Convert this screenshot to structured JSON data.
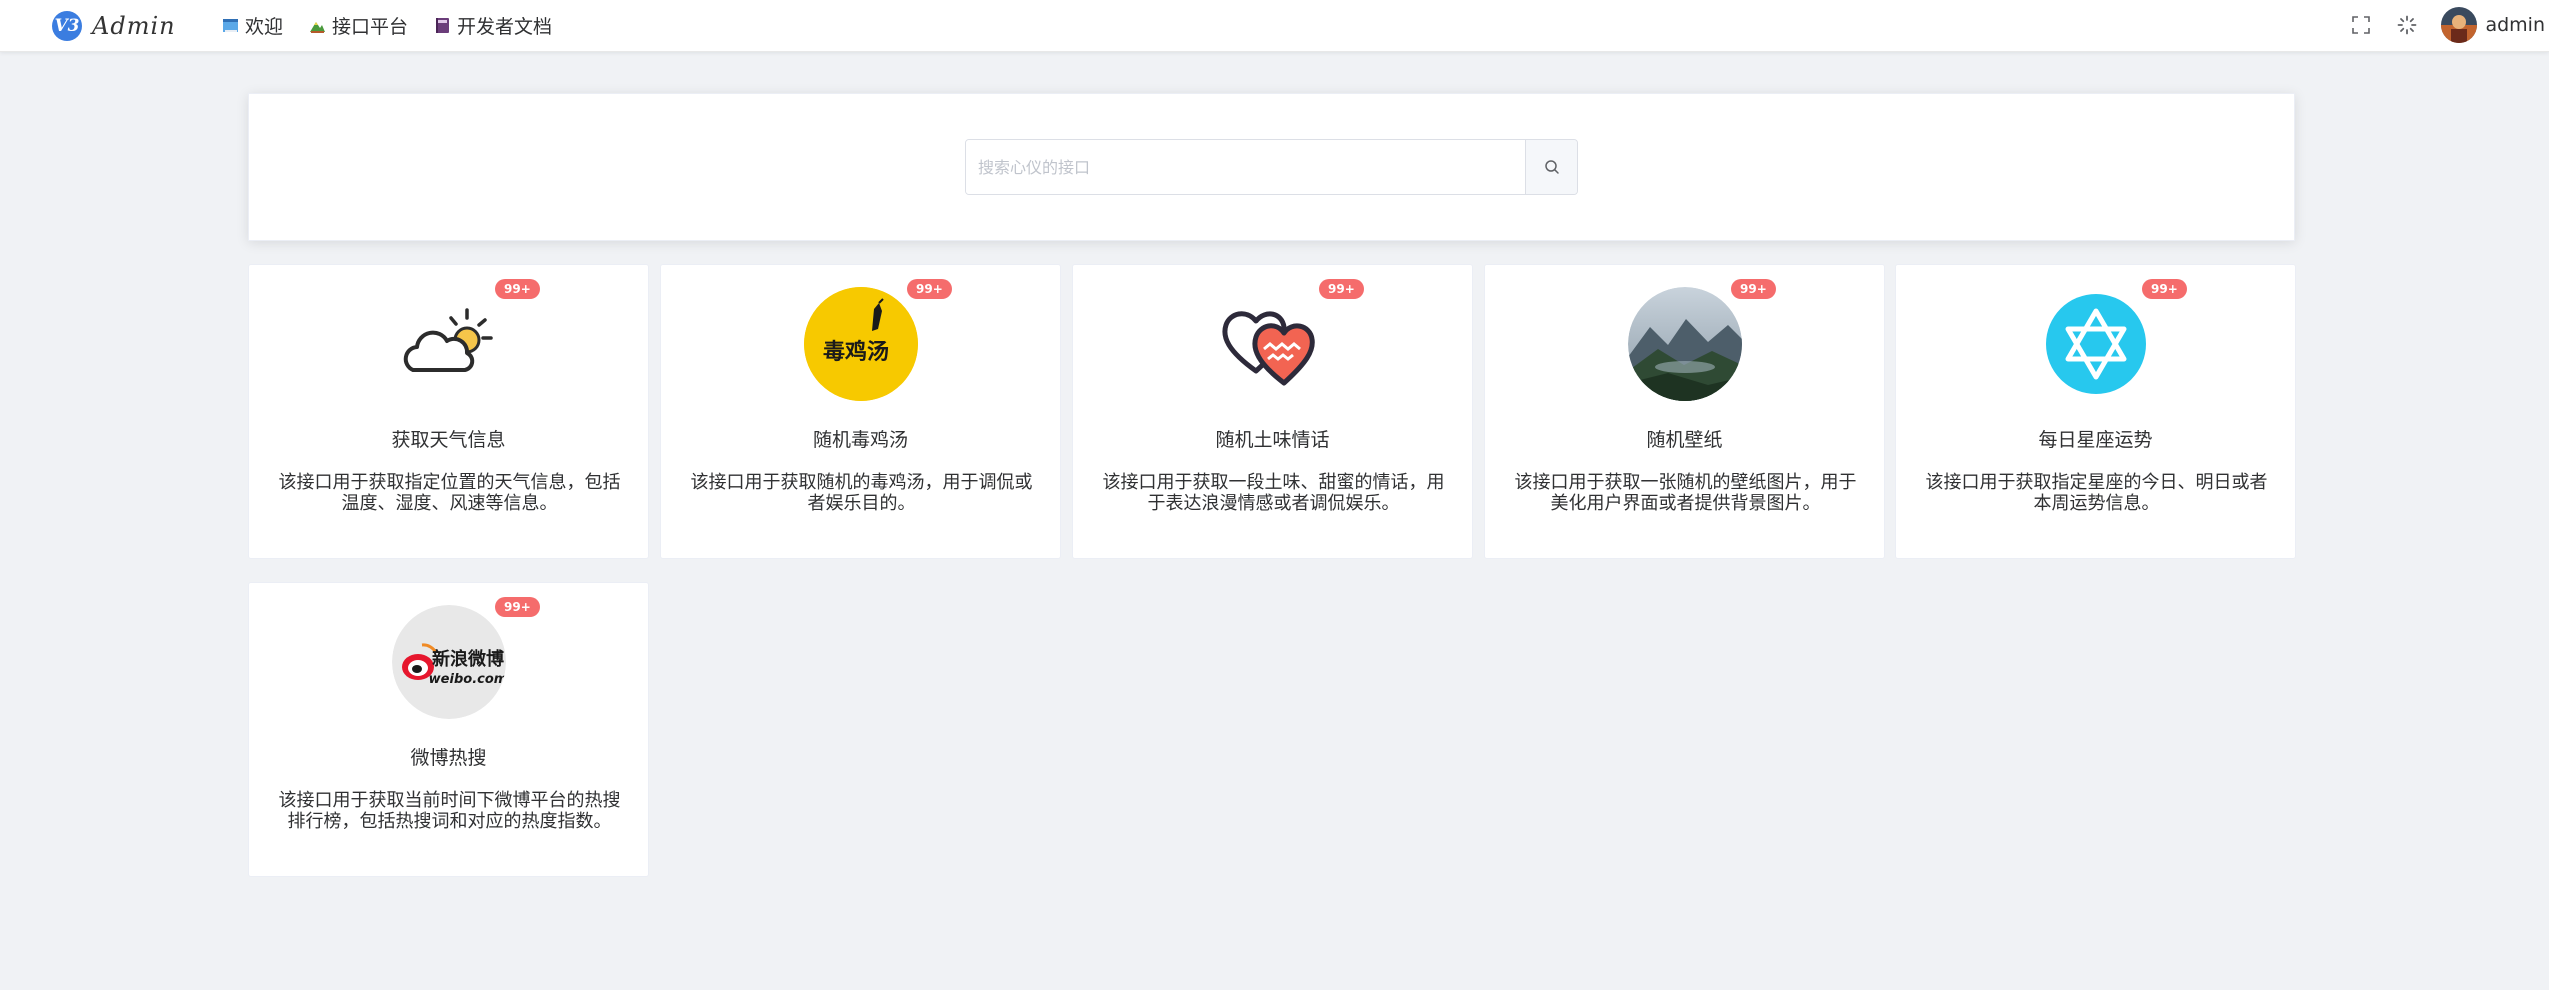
{
  "app": {
    "logo_mark": "V3",
    "logo_text": "Admin"
  },
  "nav": [
    {
      "label": "欢迎",
      "icon": "book-icon"
    },
    {
      "label": "接口平台",
      "icon": "mountain-icon"
    },
    {
      "label": "开发者文档",
      "icon": "notebook-icon"
    }
  ],
  "header_right": {
    "username": "admin"
  },
  "search": {
    "placeholder": "搜索心仪的接口"
  },
  "cards": [
    {
      "title": "获取天气信息",
      "desc": "该接口用于获取指定位置的天气信息，包括温度、湿度、风速等信息。",
      "badge": "99+",
      "icon": "weather-cloud-sun-icon"
    },
    {
      "title": "随机毒鸡汤",
      "desc": "该接口用于获取随机的毒鸡汤，用于调侃或者娱乐目的。",
      "badge": "99+",
      "icon": "chicken-soup-icon"
    },
    {
      "title": "随机土味情话",
      "desc": "该接口用于获取一段土味、甜蜜的情话，用于表达浪漫情感或者调侃娱乐。",
      "badge": "99+",
      "icon": "hearts-icon"
    },
    {
      "title": "随机壁纸",
      "desc": "该接口用于获取一张随机的壁纸图片，用于美化用户界面或者提供背景图片。",
      "badge": "99+",
      "icon": "landscape-wallpaper-icon"
    },
    {
      "title": "每日星座运势",
      "desc": "该接口用于获取指定星座的今日、明日或者本周运势信息。",
      "badge": "99+",
      "icon": "hexagram-star-icon"
    },
    {
      "title": "微博热搜",
      "desc": "该接口用于获取当前时间下微博平台的热搜排行榜，包括热搜词和对应的热度指数。",
      "badge": "99+",
      "icon": "weibo-logo-icon",
      "logo_text_cn": "新浪微博",
      "logo_text_en": "weibo.com"
    }
  ]
}
